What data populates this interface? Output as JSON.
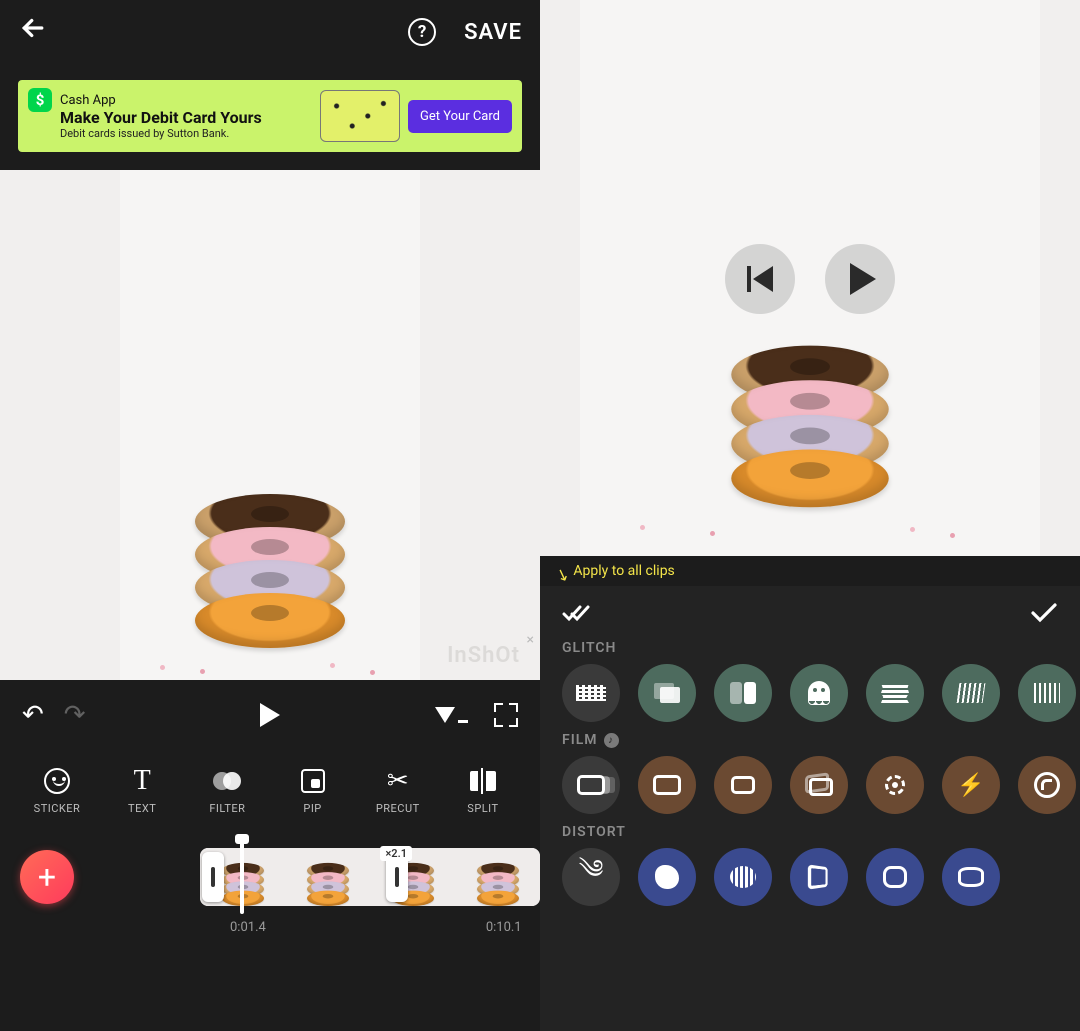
{
  "left": {
    "topbar": {
      "save": "SAVE"
    },
    "ad": {
      "brand": "Cash App",
      "headline": "Make Your Debit Card Yours",
      "sub": "Debit cards issued by Sutton Bank.",
      "cta": "Get Your Card"
    },
    "watermark": "InShOt",
    "tools": [
      {
        "id": "sticker",
        "label": "STICKER"
      },
      {
        "id": "text",
        "label": "TEXT"
      },
      {
        "id": "filter",
        "label": "FILTER"
      },
      {
        "id": "pip",
        "label": "PIP"
      },
      {
        "id": "precut",
        "label": "PRECUT"
      },
      {
        "id": "split",
        "label": "SPLIT"
      }
    ],
    "timeline": {
      "clip_speed_badge": "2.1",
      "t_current": "0:01.4",
      "t_end": "0:10.1"
    }
  },
  "right": {
    "hint": "Apply to all clips",
    "categories": [
      {
        "id": "glitch",
        "label": "GLITCH",
        "has_music": false,
        "effects": [
          "noise",
          "rgb-shift",
          "split",
          "ghost",
          "scramble",
          "scanlines",
          "edge"
        ]
      },
      {
        "id": "film",
        "label": "FILM",
        "has_music": true,
        "effects": [
          "frame-blur",
          "frame",
          "frame-small",
          "flip",
          "target",
          "flash",
          "lens"
        ]
      },
      {
        "id": "distort",
        "label": "DISTORT",
        "has_music": false,
        "effects": [
          "swirl",
          "blob",
          "ridged",
          "pinch",
          "cushion",
          "barrel"
        ]
      }
    ]
  }
}
